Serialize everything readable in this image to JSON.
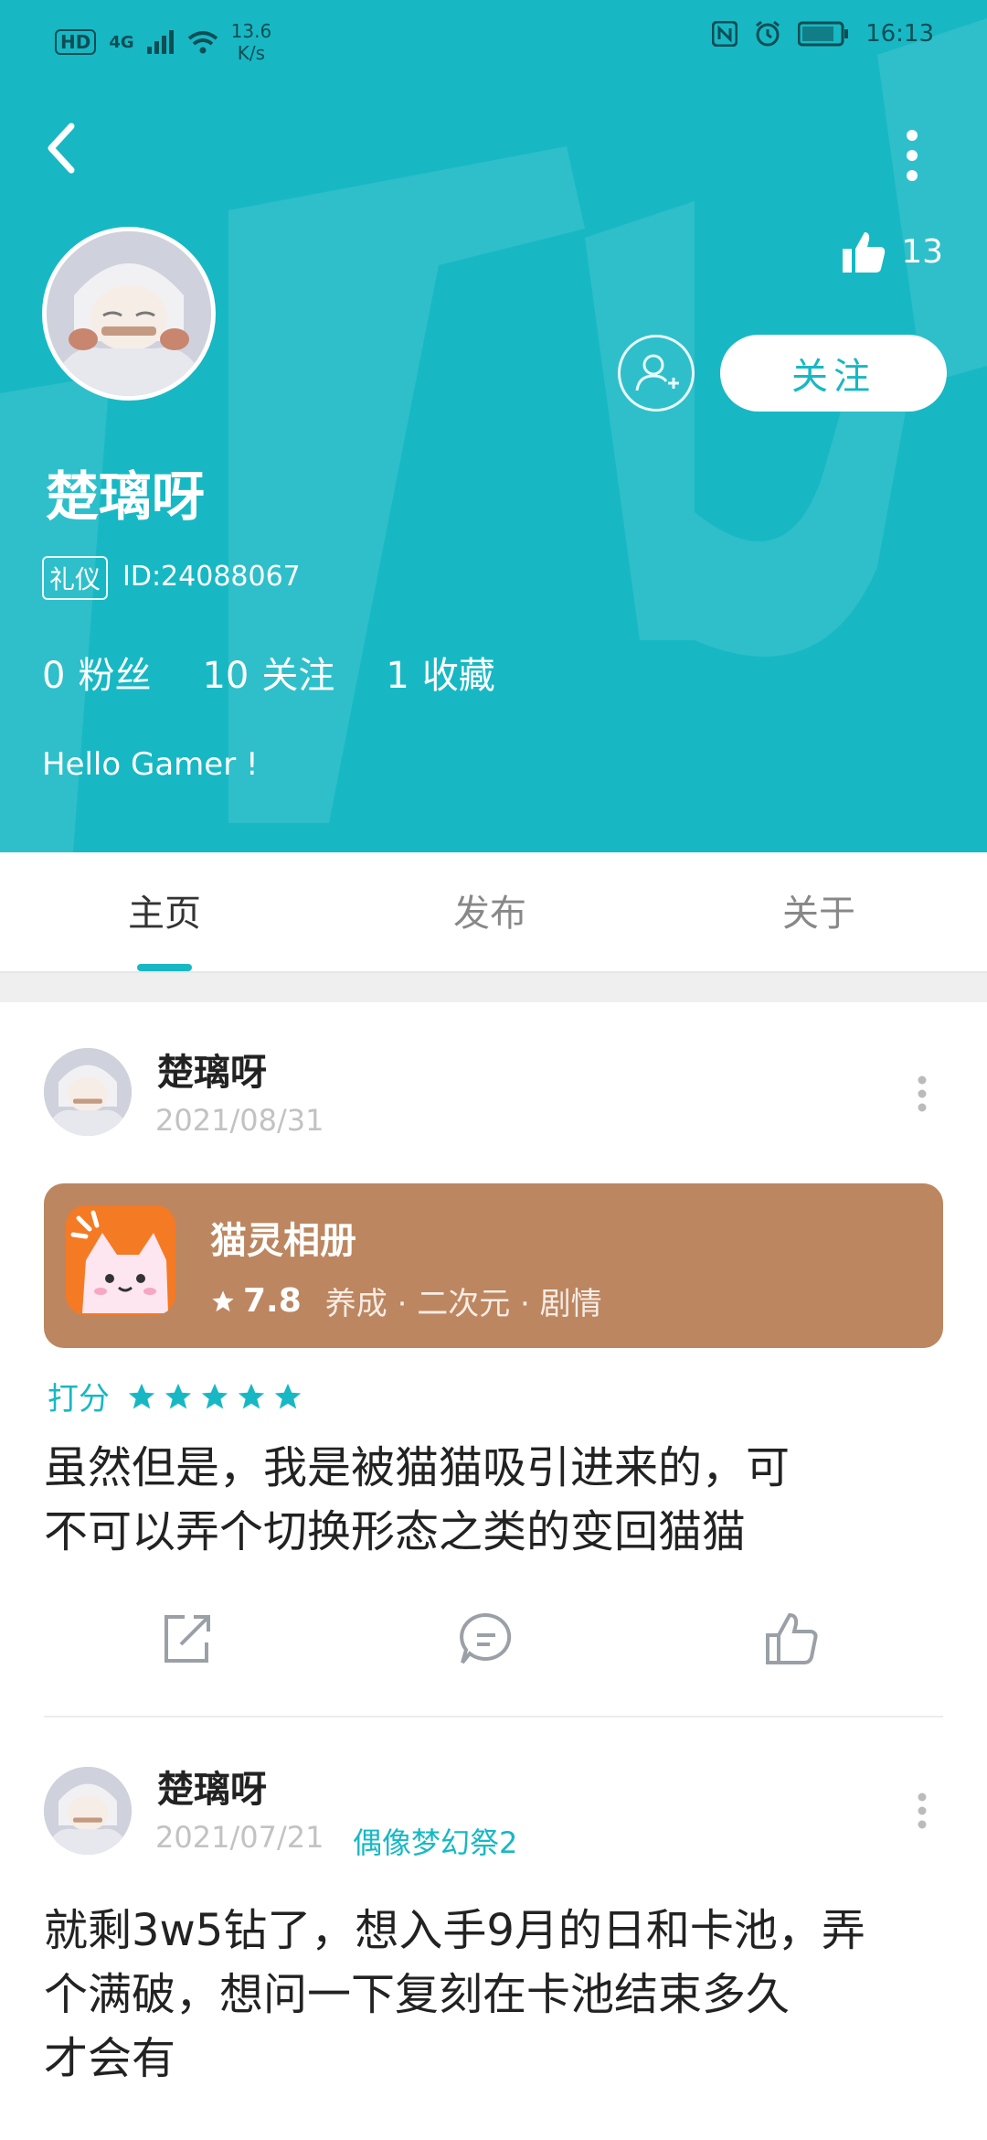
{
  "status_bar": {
    "left_badge": "HD",
    "network": "4G",
    "speed_value": "13.6",
    "speed_unit": "K/s",
    "time": "16:13"
  },
  "colors": {
    "accent": "#17b8c4",
    "card_bg": "#bc8660",
    "game_icon_bg": "#f47a24"
  },
  "profile": {
    "name": "楚璃呀",
    "badge": "礼仪",
    "id_text": "ID:24088067",
    "likes": "13",
    "follow_label": "关注",
    "stats": [
      {
        "value": "0",
        "label": "粉丝"
      },
      {
        "value": "10",
        "label": "关注"
      },
      {
        "value": "1",
        "label": "收藏"
      }
    ],
    "bio": "Hello Gamer !"
  },
  "tabs": [
    {
      "label": "主页",
      "active": true
    },
    {
      "label": "发布",
      "active": false
    },
    {
      "label": "关于",
      "active": false
    }
  ],
  "posts": [
    {
      "author": "楚璃呀",
      "date": "2021/08/31",
      "game": {
        "title": "猫灵相册",
        "score": "7.8",
        "tags": "养成 · 二次元 · 剧情"
      },
      "rating_label": "打分",
      "rating_stars": 5,
      "text_line1": "虽然但是，我是被猫猫吸引进来的，可",
      "text_line2": "不可以弄个切换形态之类的变回猫猫"
    },
    {
      "author": "楚璃呀",
      "date": "2021/07/21",
      "tag": "偶像梦幻祭2",
      "text_line1": "就剩3w5钻了，想入手9月的日和卡池，弄",
      "text_line2": "个满破，想问一下复刻在卡池结束多久",
      "text_line3": "才会有"
    }
  ],
  "icons": {
    "back": "chevron-left-icon",
    "more": "more-vertical-icon",
    "like": "thumbs-up-icon",
    "add_friend": "add-user-icon",
    "share": "share-icon",
    "comment": "comment-icon",
    "star": "star-icon"
  }
}
